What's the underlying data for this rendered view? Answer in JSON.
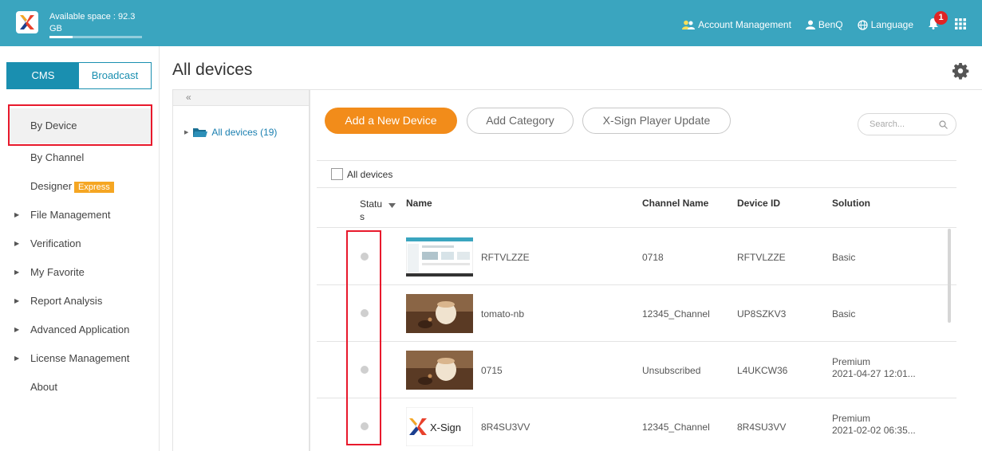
{
  "header": {
    "space_text": "Available space : 92.3 GB",
    "space_used_fraction": 0.25,
    "account_management": "Account Management",
    "user": "BenQ",
    "language": "Language",
    "notification_count": "1",
    "icons": [
      "logo-icon",
      "users-icon",
      "user-icon",
      "globe-icon",
      "bell-icon",
      "apps-grid-icon"
    ]
  },
  "sidebar": {
    "tabs": {
      "cms": "CMS",
      "broadcast": "Broadcast"
    },
    "items": [
      {
        "label": "By Device",
        "selected": true
      },
      {
        "label": "By Channel"
      },
      {
        "label": "Designer",
        "badge": "Express"
      },
      {
        "label": "File Management",
        "expandable": true
      },
      {
        "label": "Verification",
        "expandable": true
      },
      {
        "label": "My Favorite",
        "expandable": true
      },
      {
        "label": "Report Analysis",
        "expandable": true
      },
      {
        "label": "Advanced Application",
        "expandable": true
      },
      {
        "label": "License Management",
        "expandable": true
      },
      {
        "label": "About"
      }
    ]
  },
  "main": {
    "title": "All devices",
    "collapse_label": "«",
    "tree_root": "All devices (19)",
    "toolbar": {
      "add_device": "Add a New Device",
      "add_category": "Add Category",
      "player_update": "X-Sign Player Update",
      "search_placeholder": "Search..."
    },
    "select_all_label": "All devices",
    "columns": {
      "status": "Statu s",
      "name": "Name",
      "channel": "Channel Name",
      "device_id": "Device ID",
      "solution": "Solution"
    },
    "rows": [
      {
        "name": "RFTVLZZE",
        "channel": "0718",
        "device_id": "RFTVLZZE",
        "solution": "Basic",
        "solution_date": ""
      },
      {
        "name": "tomato-nb",
        "channel": "12345_Channel",
        "device_id": "UP8SZKV3",
        "solution": "Basic",
        "solution_date": ""
      },
      {
        "name": "0715",
        "channel": "Unsubscribed",
        "device_id": "L4UKCW36",
        "solution": "Premium",
        "solution_date": "2021-04-27 12:01..."
      },
      {
        "name": "8R4SU3VV",
        "channel": "12345_Channel",
        "device_id": "8R4SU3VV",
        "solution": "Premium",
        "solution_date": "2021-02-02 06:35..."
      }
    ],
    "thumb_brand": "X-Sign"
  },
  "colors": {
    "header_bg": "#3aa5bf",
    "primary_blue": "#1a8fb0",
    "accent_orange": "#f28c1a",
    "badge_red": "#e02424",
    "highlight_red": "#e8192c"
  }
}
